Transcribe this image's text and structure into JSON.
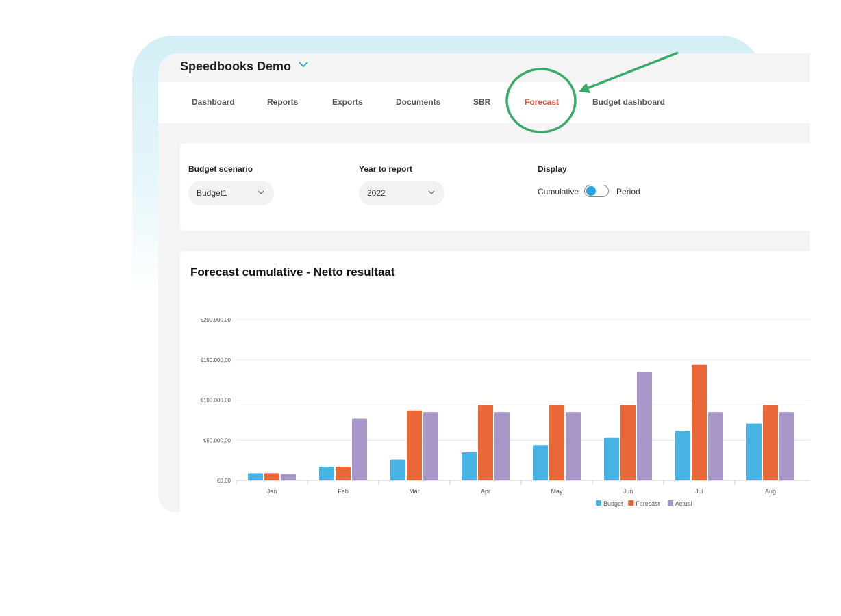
{
  "header": {
    "title": "Speedbooks Demo"
  },
  "nav": {
    "items": [
      {
        "label": "Dashboard",
        "active": false
      },
      {
        "label": "Reports",
        "active": false
      },
      {
        "label": "Exports",
        "active": false
      },
      {
        "label": "Documents",
        "active": false
      },
      {
        "label": "SBR",
        "active": false
      },
      {
        "label": "Forecast",
        "active": true
      },
      {
        "label": "Budget dashboard",
        "active": false
      }
    ]
  },
  "filters": {
    "budget_scenario": {
      "label": "Budget scenario",
      "value": "Budget1"
    },
    "year": {
      "label": "Year to report",
      "value": "2022"
    },
    "display": {
      "label": "Display",
      "left_option": "Cumulative",
      "right_option": "Period",
      "selected": "Cumulative"
    }
  },
  "colors": {
    "accent": "#e8542a",
    "toggle": "#29a3e0",
    "annotation": "#3aaa6a"
  },
  "chart_data": {
    "type": "bar",
    "title": "Forecast cumulative - Netto resultaat",
    "categories": [
      "Jan",
      "Feb",
      "Mar",
      "Apr",
      "May",
      "Jun",
      "Jul",
      "Aug"
    ],
    "series": [
      {
        "name": "Budget",
        "color": "#47b3e3",
        "values": [
          9000,
          17000,
          26000,
          35000,
          44000,
          53000,
          62000,
          71000
        ]
      },
      {
        "name": "Forecast",
        "color": "#ea6737",
        "values": [
          9000,
          17000,
          87000,
          94000,
          94000,
          94000,
          144000,
          94000
        ]
      },
      {
        "name": "Actual",
        "color": "#a896c8",
        "values": [
          8000,
          77000,
          85000,
          85000,
          85000,
          135000,
          85000,
          85000
        ]
      }
    ],
    "yticks": [
      "€0,00",
      "€50.000,00",
      "€100.000,00",
      "€150.000,00",
      "€200.000,00"
    ],
    "ylim": [
      0,
      200000
    ],
    "grid": true,
    "legend": "bottom"
  }
}
